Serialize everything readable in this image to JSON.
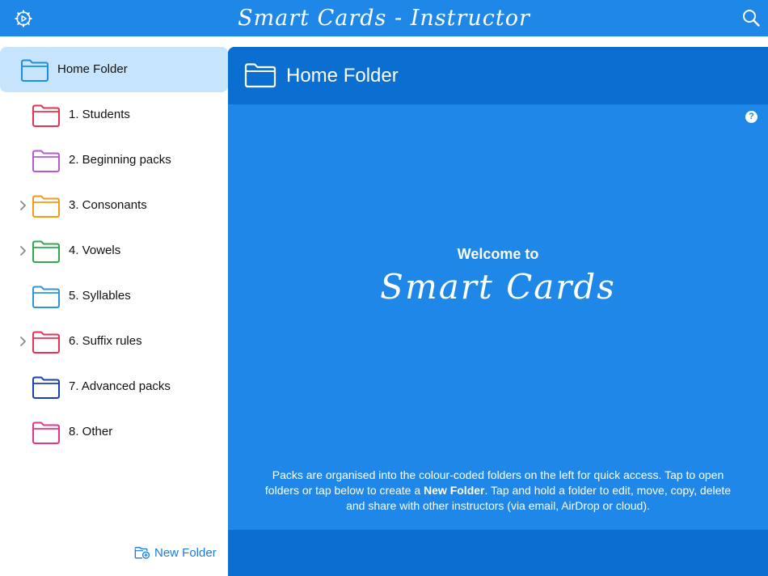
{
  "app": {
    "title": "Smart Cards - Instructor"
  },
  "sidebar": {
    "items": [
      {
        "label": "Home Folder",
        "color": "#1a8fe0",
        "expandable": false,
        "selected": true
      },
      {
        "label": "1. Students",
        "color": "#e8304f",
        "expandable": false,
        "selected": false
      },
      {
        "label": "2. Beginning packs",
        "color": "#b35bd6",
        "expandable": false,
        "selected": false
      },
      {
        "label": "3. Consonants",
        "color": "#f59a16",
        "expandable": true,
        "selected": false
      },
      {
        "label": "4. Vowels",
        "color": "#2fa84f",
        "expandable": true,
        "selected": false
      },
      {
        "label": "5. Syllables",
        "color": "#2e95dc",
        "expandable": false,
        "selected": false
      },
      {
        "label": "6. Suffix rules",
        "color": "#e83258",
        "expandable": true,
        "selected": false
      },
      {
        "label": "7. Advanced packs",
        "color": "#1a3fb3",
        "expandable": false,
        "selected": false
      },
      {
        "label": "8. Other",
        "color": "#e8338a",
        "expandable": false,
        "selected": false
      }
    ],
    "new_folder_label": "New Folder"
  },
  "main": {
    "title": "Home Folder",
    "help_label": "?",
    "welcome": "Welcome to",
    "brand": "Smart Cards",
    "description": {
      "part1": "Packs are organised into the colour-coded folders on the left for quick access. Tap to open folders or tap below to create a ",
      "bold": "New Folder",
      "part2": ". Tap and hold a folder to edit, move, copy, delete and share with other instructors (via email, AirDrop or cloud)."
    }
  },
  "colors": {
    "accent": "#1e87e8",
    "header_dark": "#0a6fd0",
    "selected_row": "#c6e4fb",
    "link": "#1a7be0"
  }
}
